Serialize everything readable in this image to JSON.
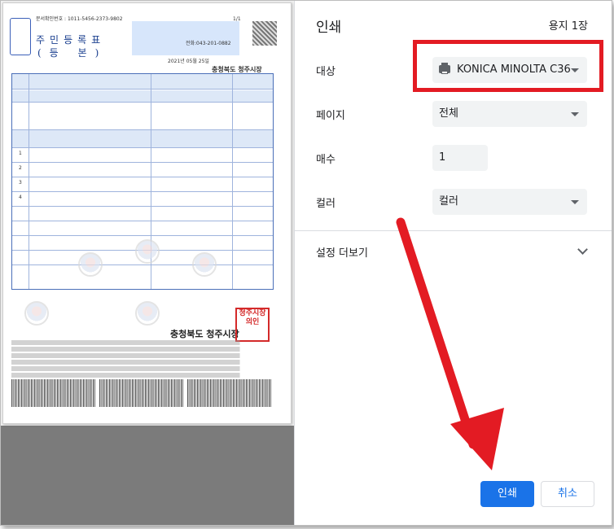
{
  "dialog": {
    "title": "인쇄",
    "sheet_count": "용지 1장",
    "destination": {
      "label": "대상",
      "value": "KONICA MINOLTA C36"
    },
    "pages": {
      "label": "페이지",
      "value": "전체"
    },
    "copies": {
      "label": "매수",
      "value": "1"
    },
    "color": {
      "label": "컬러",
      "value": "컬러"
    },
    "more_settings": "설정 더보기",
    "print_button": "인쇄",
    "cancel_button": "취소"
  },
  "preview": {
    "doc_number": "문서확인번호 : 1011-5456-2373-9802",
    "page_indicator": "1/1",
    "doc_title": "주민등록표",
    "doc_subtitle": "(등 본)",
    "issuer_header": "충청북도 청주시장",
    "date": "2021년 05월 25일",
    "phone": "전화:043-201-0882",
    "footer_issuer": "충청북도 청주시장",
    "seal_text": "청주시장의인",
    "row_numbers": [
      "1",
      "2",
      "3",
      "4"
    ]
  },
  "colors": {
    "accent": "#1a73e8",
    "annotation": "#e31b23"
  }
}
